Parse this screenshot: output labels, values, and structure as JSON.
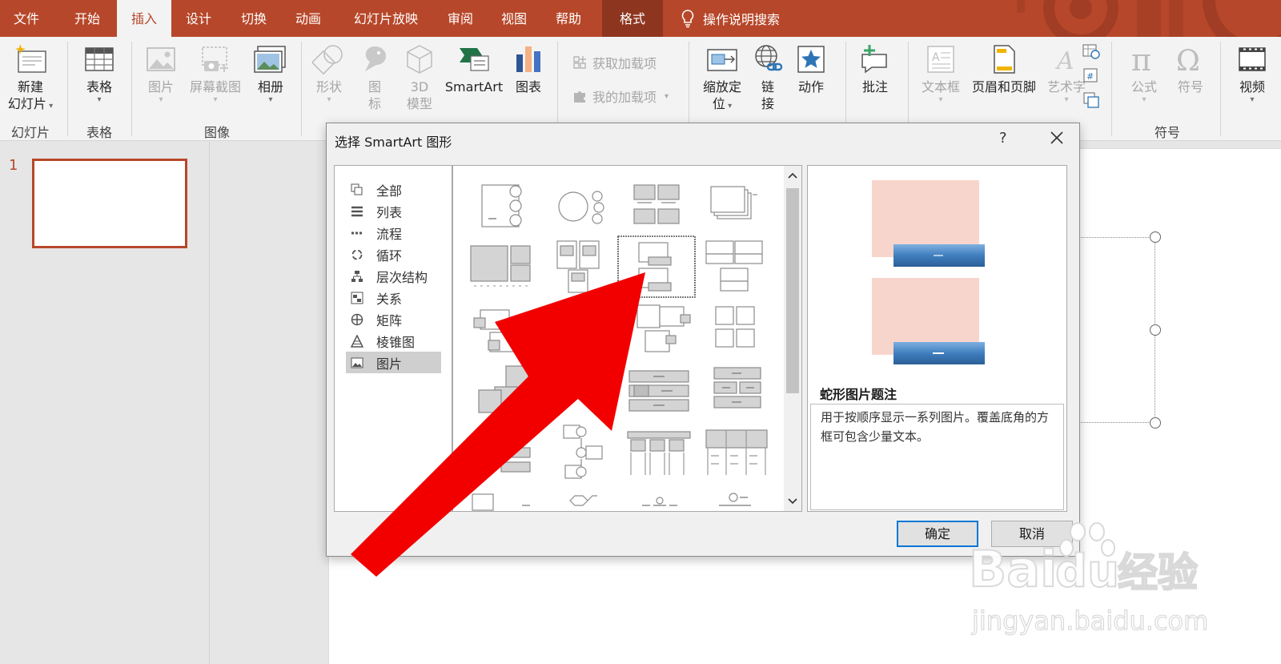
{
  "tabs": [
    "文件",
    "开始",
    "插入",
    "设计",
    "切换",
    "动画",
    "幻灯片放映",
    "审阅",
    "视图",
    "帮助",
    "格式"
  ],
  "help_search": "操作说明搜索",
  "ribbon": {
    "new_slide": [
      "新建",
      "幻灯片"
    ],
    "table": "表格",
    "picture": "图片",
    "screenshot": "屏幕截图",
    "album": "相册",
    "shapes": "形状",
    "icons": [
      "图",
      "标"
    ],
    "model3d": [
      "3D",
      "模型"
    ],
    "smartart": "SmartArt",
    "chart": "图表",
    "get_addins": "获取加载项",
    "my_addins": "我的加载项",
    "zoom": [
      "缩放定",
      "位"
    ],
    "link": [
      "链",
      "接"
    ],
    "action": "动作",
    "comment": "批注",
    "textbox": "文本框",
    "header_footer": "页眉和页脚",
    "wordart": "艺术字",
    "equation": "公式",
    "symbol": "符号",
    "video": "视频",
    "groups": {
      "slides": "幻灯片",
      "tables": "表格",
      "images": "图像",
      "symbols": "符号"
    }
  },
  "slide_number": "1",
  "dialog": {
    "title": "选择 SmartArt 图形",
    "help": "?",
    "categories": [
      "全部",
      "列表",
      "流程",
      "循环",
      "层次结构",
      "关系",
      "矩阵",
      "棱锥图",
      "图片"
    ],
    "selected_category": "图片",
    "preview_title": "蛇形图片题注",
    "preview_desc": "用于按顺序显示一系列图片。覆盖底角的方框可包含少量文本。",
    "ok": "确定",
    "cancel": "取消"
  },
  "watermark": {
    "brand": "Bai",
    "brand2": "du",
    "site": "经验",
    "url": "jingyan.baidu.com"
  },
  "colors": {
    "accent": "#b7472a",
    "arrow": "#f20000",
    "preview_pink": "#f8d5cc",
    "preview_blue": "#3f7ebe"
  }
}
